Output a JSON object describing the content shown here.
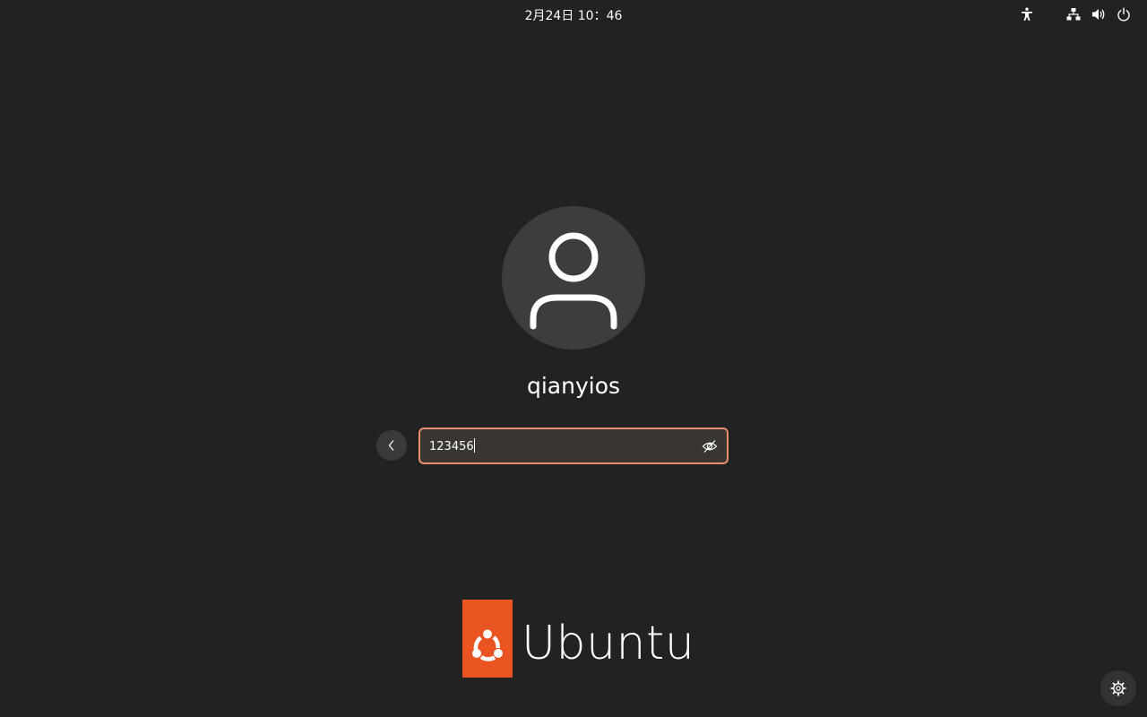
{
  "topbar": {
    "clock": "2月24日  10：46",
    "icons": {
      "accessibility": "accessibility-icon",
      "network": "network-icon",
      "volume": "volume-icon",
      "power": "power-icon"
    }
  },
  "login": {
    "avatar_icon": "user-avatar-icon",
    "username": "qianyios",
    "password_value": "123456",
    "back_icon": "chevron-left-icon",
    "reveal_icon": "eye-slash-icon"
  },
  "branding": {
    "logo_word": "Ubuntu",
    "logo_icon": "ubuntu-circle-of-friends-icon",
    "brand_color": "#e95420"
  },
  "bottom": {
    "session_icon": "gear-icon"
  },
  "colors": {
    "background": "#222222",
    "field_border": "#e98f6e",
    "field_background": "#3a3632",
    "avatar_background": "#3d3d3d"
  }
}
